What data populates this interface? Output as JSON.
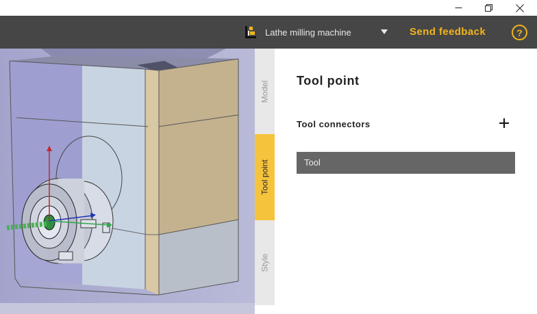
{
  "window": {
    "controls": [
      "minimize-icon",
      "restore-icon",
      "close-icon"
    ]
  },
  "header": {
    "machine_label": "Lathe milling machine",
    "feedback_label": "Send feedback",
    "help_label": "?",
    "accent_color": "#f2b51b",
    "bar_color": "#464646"
  },
  "tabs": [
    {
      "label": "Model",
      "active": false
    },
    {
      "label": "Tool point",
      "active": true
    },
    {
      "label": "Style",
      "active": false
    }
  ],
  "panel": {
    "title": "Tool point",
    "section_label": "Tool connectors",
    "connectors": [
      {
        "label": "Tool"
      }
    ]
  }
}
